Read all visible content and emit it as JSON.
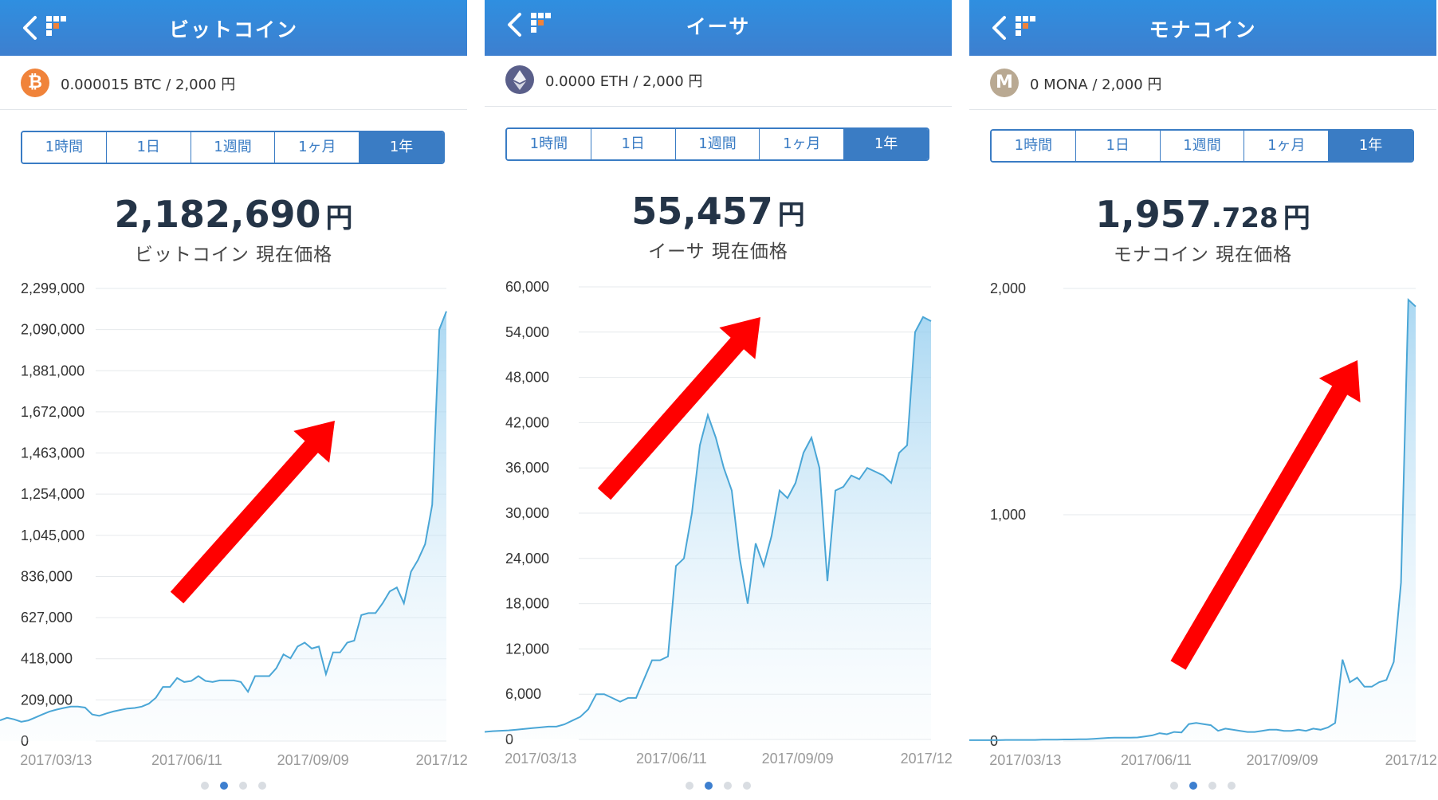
{
  "tabs": [
    "1時間",
    "1日",
    "1週間",
    "1ヶ月",
    "1年"
  ],
  "active_tab": "1年",
  "icons": {
    "back": "chevron-left-icon",
    "logo": "brand-logo-icon"
  },
  "colors": {
    "header": "#3d7fcf",
    "line": "#4aa6d6",
    "arrow": "#ff0000"
  },
  "panels": [
    {
      "title": "ビットコイン",
      "coin_icon": "bitcoin-icon",
      "coin_symbol": "₿",
      "coin_color": "#f0833a",
      "holding": "0.000015 BTC / 2,000 円",
      "price_int": "2,182,690",
      "price_dec": "",
      "price_unit": "円",
      "price_label": "ビットコイン 現在価格",
      "page_indicator": {
        "count": 4,
        "active": 1
      },
      "chart_data": {
        "type": "area",
        "x_tick_labels": [
          "2017/03/13",
          "2017/06/11",
          "2017/09/09",
          "2017/12/"
        ],
        "y_tick_labels": [
          "0",
          "209,000",
          "418,000",
          "627,000",
          "836,000",
          "1,045,000",
          "1,254,000",
          "1,463,000",
          "1,672,000",
          "1,881,000",
          "2,090,000",
          "2,299,000"
        ],
        "ylim": [
          0,
          2299000
        ],
        "values": [
          105000,
          118000,
          110000,
          98000,
          105000,
          120000,
          135000,
          150000,
          160000,
          168000,
          175000,
          175000,
          170000,
          135000,
          128000,
          140000,
          150000,
          158000,
          165000,
          168000,
          175000,
          190000,
          220000,
          275000,
          275000,
          320000,
          300000,
          305000,
          330000,
          305000,
          300000,
          308000,
          308000,
          308000,
          300000,
          250000,
          330000,
          330000,
          330000,
          370000,
          440000,
          420000,
          480000,
          500000,
          470000,
          480000,
          340000,
          450000,
          450000,
          500000,
          510000,
          640000,
          650000,
          650000,
          700000,
          760000,
          780000,
          700000,
          860000,
          920000,
          1000000,
          1200000,
          2090000,
          2182690
        ]
      }
    },
    {
      "title": "イーサ",
      "coin_icon": "ethereum-icon",
      "coin_symbol": "◆",
      "coin_color": "#5a5f8a",
      "holding": "0.0000 ETH / 2,000 円",
      "price_int": "55,457",
      "price_dec": "",
      "price_unit": "円",
      "price_label": "イーサ 現在価格",
      "page_indicator": {
        "count": 4,
        "active": 1
      },
      "chart_data": {
        "type": "area",
        "x_tick_labels": [
          "2017/03/13",
          "2017/06/11",
          "2017/09/09",
          "2017/12/"
        ],
        "y_tick_labels": [
          "0",
          "6,000",
          "12,000",
          "18,000",
          "24,000",
          "30,000",
          "36,000",
          "42,000",
          "48,000",
          "54,000",
          "60,000"
        ],
        "ylim": [
          0,
          60000
        ],
        "values": [
          1000,
          1100,
          1150,
          1200,
          1300,
          1400,
          1500,
          1600,
          1700,
          1700,
          2000,
          2500,
          3000,
          4000,
          6000,
          6000,
          5500,
          5000,
          5500,
          5500,
          8000,
          10500,
          10500,
          11000,
          23000,
          24000,
          30000,
          39000,
          43000,
          40000,
          36000,
          33000,
          24000,
          18000,
          26000,
          23000,
          27000,
          33000,
          32000,
          34000,
          38000,
          40000,
          36000,
          21000,
          33000,
          33500,
          35000,
          34500,
          36000,
          35500,
          35000,
          34000,
          38000,
          39000,
          54000,
          56000,
          55457
        ]
      }
    },
    {
      "title": "モナコイン",
      "coin_icon": "monacoin-icon",
      "coin_symbol": "M",
      "coin_color": "#b9a992",
      "holding": "0 MONA / 2,000 円",
      "price_int": "1,957",
      "price_dec": ".728",
      "price_unit": "円",
      "price_label": "モナコイン 現在価格",
      "page_indicator": {
        "count": 4,
        "active": 1
      },
      "chart_data": {
        "type": "area",
        "x_tick_labels": [
          "2017/03/13",
          "2017/06/11",
          "2017/09/09",
          "2017/12/"
        ],
        "y_tick_labels": [
          "0",
          "1,000",
          "2,000"
        ],
        "ylim": [
          0,
          2000
        ],
        "values": [
          4,
          4,
          4,
          4,
          4,
          5,
          5,
          5,
          5,
          5,
          6,
          6,
          6,
          7,
          7,
          8,
          8,
          10,
          12,
          14,
          15,
          15,
          15,
          16,
          20,
          25,
          35,
          30,
          40,
          38,
          75,
          80,
          75,
          70,
          45,
          55,
          50,
          45,
          40,
          40,
          45,
          50,
          50,
          45,
          45,
          50,
          45,
          55,
          50,
          60,
          80,
          360,
          260,
          280,
          240,
          240,
          260,
          270,
          350,
          700,
          1950,
          1920
        ]
      }
    }
  ]
}
